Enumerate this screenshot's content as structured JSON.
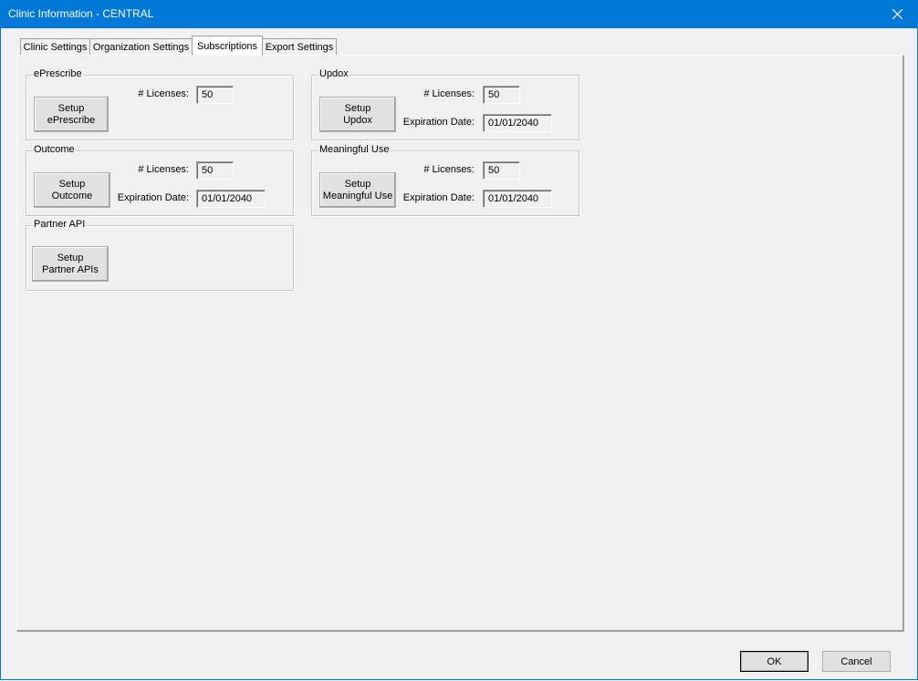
{
  "window": {
    "title": "Clinic Information - CENTRAL"
  },
  "tabs": [
    {
      "label": "Clinic Settings"
    },
    {
      "label": "Organization Settings"
    },
    {
      "label": "Subscriptions"
    },
    {
      "label": "Export Settings"
    }
  ],
  "active_tab": "Subscriptions",
  "eprescribe": {
    "title": "ePrescribe",
    "button": "Setup\nePrescribe",
    "licenses_label": "# Licenses:",
    "licenses": "50"
  },
  "updox": {
    "title": "Updox",
    "button": "Setup\nUpdox",
    "licenses_label": "# Licenses:",
    "licenses": "50",
    "expiration_label": "Expiration Date:",
    "expiration": "01/01/2040"
  },
  "outcome": {
    "title": "Outcome",
    "button": "Setup\nOutcome",
    "licenses_label": "# Licenses:",
    "licenses": "50",
    "expiration_label": "Expiration Date:",
    "expiration": "01/01/2040"
  },
  "meaningful_use": {
    "title": "Meaningful Use",
    "button": "Setup\nMeaningful Use",
    "licenses_label": "# Licenses:",
    "licenses": "50",
    "expiration_label": "Expiration Date:",
    "expiration": "01/01/2040"
  },
  "partner_api": {
    "title": "Partner API",
    "button": "Setup\nPartner APIs"
  },
  "footer": {
    "ok": "OK",
    "cancel": "Cancel"
  }
}
